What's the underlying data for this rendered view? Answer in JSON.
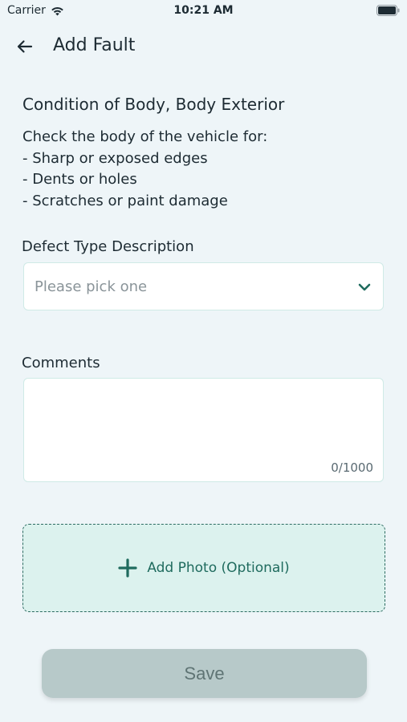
{
  "status_bar": {
    "carrier": "Carrier",
    "time": "10:21 AM"
  },
  "header": {
    "title": "Add Fault",
    "back_icon": "arrow-left-icon"
  },
  "section": {
    "title": "Condition of Body, Body Exterior",
    "intro": "Check the body of the vehicle for:",
    "items": [
      "- Sharp or exposed edges",
      "- Dents or holes",
      "- Scratches or paint damage"
    ]
  },
  "defect_type": {
    "label": "Defect Type Description",
    "placeholder": "Please pick one",
    "icon": "chevron-down-icon"
  },
  "comments": {
    "label": "Comments",
    "value": "",
    "char_count": "0/1000"
  },
  "photo": {
    "label": "Add Photo (Optional)",
    "icon": "plus-icon"
  },
  "save": {
    "label": "Save"
  },
  "colors": {
    "background": "#eef5f8",
    "accent": "#1f6b5e",
    "photo_bg": "#dcf2ee",
    "button_disabled": "#b7c9c9"
  }
}
